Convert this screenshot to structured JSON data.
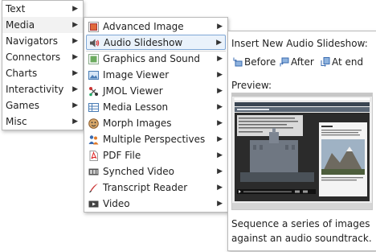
{
  "menu1": {
    "items": [
      {
        "label": "Text"
      },
      {
        "label": "Media"
      },
      {
        "label": "Navigators"
      },
      {
        "label": "Connectors"
      },
      {
        "label": "Charts"
      },
      {
        "label": "Interactivity"
      },
      {
        "label": "Games"
      },
      {
        "label": "Misc"
      }
    ],
    "active_item": "Media"
  },
  "menu2": {
    "items": [
      {
        "label": "Advanced Image",
        "icon": "advanced-image-icon"
      },
      {
        "label": "Audio Slideshow",
        "icon": "speaker-icon"
      },
      {
        "label": "Graphics and Sound",
        "icon": "graphics-sound-icon"
      },
      {
        "label": "Image Viewer",
        "icon": "image-viewer-icon"
      },
      {
        "label": "JMOL Viewer",
        "icon": "molecule-icon"
      },
      {
        "label": "Media Lesson",
        "icon": "media-lesson-icon"
      },
      {
        "label": "Morph Images",
        "icon": "morph-icon"
      },
      {
        "label": "Multiple Perspectives",
        "icon": "people-icon"
      },
      {
        "label": "PDF File",
        "icon": "pdf-icon"
      },
      {
        "label": "Synched Video",
        "icon": "video-film-icon"
      },
      {
        "label": "Transcript Reader",
        "icon": "quill-icon"
      },
      {
        "label": "Video",
        "icon": "video-icon"
      }
    ],
    "hover_item": "Audio Slideshow"
  },
  "panel": {
    "insert_heading": "Insert New Audio Slideshow:",
    "before_label": "Before",
    "after_label": "After",
    "at_end_label": "At end",
    "preview_heading": "Preview:",
    "description": "Sequence a series of images against an audio soundtrack."
  },
  "colors": {
    "hover_bg": "#eaf2fb",
    "hover_border": "#7fa7d6",
    "pdf_red": "#d22",
    "preview_header": "#3a4552"
  }
}
